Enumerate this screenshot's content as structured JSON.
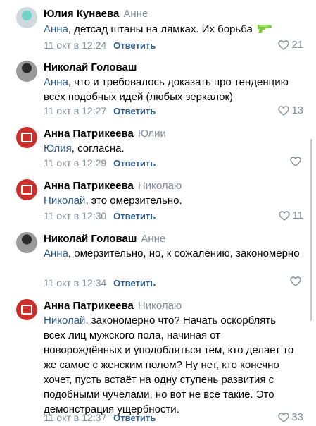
{
  "comments": [
    {
      "author": "Юлия Кунаева",
      "reply_to": "Анне",
      "mention": "Анна",
      "text": ", детсад штаны на лямках. Их борьба",
      "date": "11 окт в 12:24",
      "reply_label": "Ответить",
      "likes": "21",
      "emoji": "water-pistol-icon"
    },
    {
      "author": "Николай Головаш",
      "reply_to": "",
      "mention": "Анна",
      "text": ", что и требовалось доказать про тенденцию всех подобных идей (любых зеркалок)",
      "date": "11 окт в 12:27",
      "reply_label": "Ответить",
      "likes": "13"
    },
    {
      "author": "Анна Патрикеева",
      "reply_to": "Юлии",
      "mention": "Юлия",
      "text": ", согласна.",
      "date": "11 окт в 12:29",
      "reply_label": "Ответить",
      "likes": ""
    },
    {
      "author": "Анна Патрикеева",
      "reply_to": "Николаю",
      "mention": "Николай",
      "text": ", это омерзительно.",
      "date": "11 окт в 12:30",
      "reply_label": "Ответить",
      "likes": "11"
    },
    {
      "author": "Николай Головаш",
      "reply_to": "Анне",
      "mention": "Анна",
      "text": ", омерзительно, но, к сожалению, закономерно",
      "date": "11 окт в 12:34",
      "reply_label": "Ответить",
      "likes": ""
    },
    {
      "author": "Анна Патрикеева",
      "reply_to": "Николаю",
      "mention": "Николай",
      "text": ", закономерно что? Начать оскорблять всех лиц мужского пола, начиная от новорождённых  и уподобляться тем, кто делает то же самое с женским полом? Ну нет, кто конечно хочет, пусть встаёт на одну ступень развития с подобными чучелами, но вот не все такие. Это демонстрация ущербности.",
      "date": "11 окт в 12:37",
      "reply_label": "Ответить",
      "likes": "33"
    }
  ],
  "colors": {
    "link": "#2a5885",
    "secondary": "#818c99",
    "anna_avatar": "#c9302c"
  }
}
